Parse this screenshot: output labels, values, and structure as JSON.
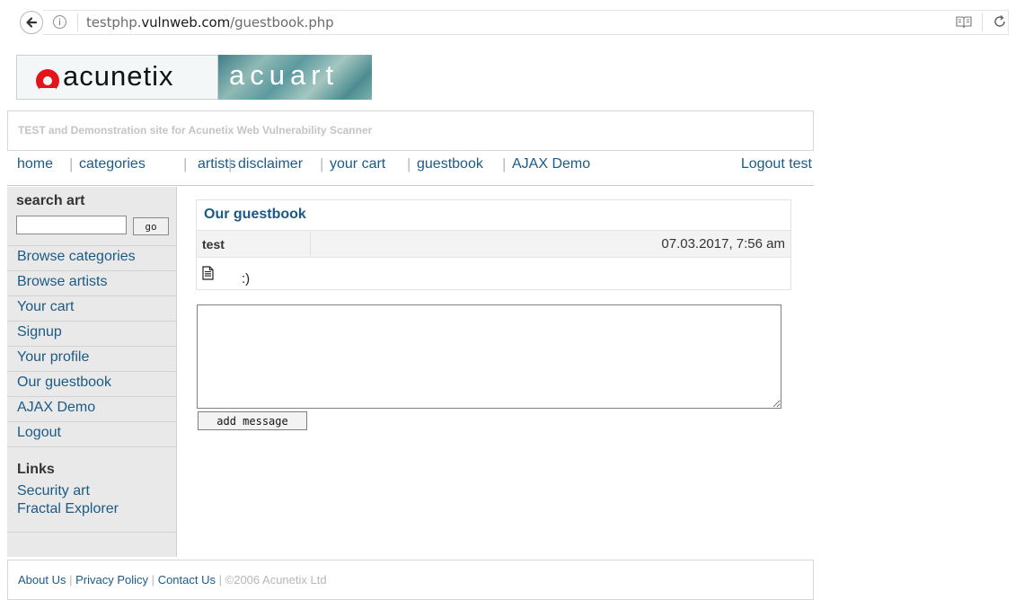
{
  "browser": {
    "url_prefix": "testphp.",
    "url_domain": "vulnweb.com",
    "url_path": "/guestbook.php"
  },
  "logo": {
    "brand": "acunetix",
    "product": "acuart"
  },
  "tagline": "TEST and Demonstration site for Acunetix Web Vulnerability Scanner",
  "nav": {
    "items": [
      {
        "label": "home"
      },
      {
        "label": "categories"
      },
      {
        "label": "artists"
      },
      {
        "label": "disclaimer"
      },
      {
        "label": "your cart"
      },
      {
        "label": "guestbook"
      },
      {
        "label": "AJAX Demo"
      }
    ],
    "logout": "Logout test",
    "separator": "|"
  },
  "sidebar": {
    "search_title": "search art",
    "search_value": "",
    "go_label": "go",
    "items": [
      {
        "label": "Browse categories"
      },
      {
        "label": "Browse artists"
      },
      {
        "label": "Your cart"
      },
      {
        "label": "Signup"
      },
      {
        "label": "Your profile"
      },
      {
        "label": "Our guestbook"
      },
      {
        "label": "AJAX Demo"
      },
      {
        "label": "Logout"
      }
    ],
    "links_title": "Links",
    "links": [
      {
        "label": "Security art"
      },
      {
        "label": "Fractal Explorer"
      }
    ]
  },
  "guestbook": {
    "title": "Our guestbook",
    "entries": [
      {
        "author": "test",
        "date": "07.03.2017, 7:56 am",
        "message": ":)"
      }
    ],
    "textarea_value": "",
    "add_button": "add message"
  },
  "footer": {
    "links": [
      {
        "label": "About Us"
      },
      {
        "label": "Privacy Policy"
      },
      {
        "label": "Contact Us"
      }
    ],
    "separator": "|",
    "copyright": "©2006 Acunetix Ltd"
  },
  "colors": {
    "link": "#1c5a85",
    "logo_red": "#e3141b",
    "muted": "#c4c4c4"
  }
}
